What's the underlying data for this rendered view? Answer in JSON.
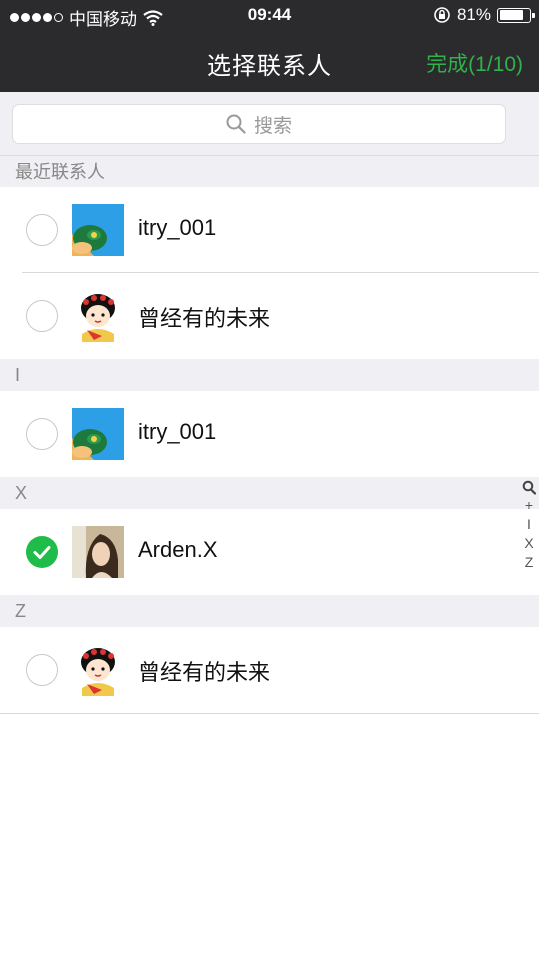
{
  "status": {
    "carrier": "中国移动",
    "time": "09:44",
    "battery": "81%",
    "battery_level": 0.81
  },
  "nav": {
    "title": "选择联系人",
    "done": "完成(1/10)"
  },
  "search": {
    "placeholder": "搜索"
  },
  "sections": [
    {
      "header": "最近联系人",
      "contacts": [
        {
          "name": "itry_001",
          "avatar": "hat-avatar",
          "selected": false
        },
        {
          "name": "曾经有的未来",
          "avatar": "cartoon-girl-avatar",
          "selected": false
        }
      ]
    },
    {
      "header": "I",
      "contacts": [
        {
          "name": "itry_001",
          "avatar": "hat-avatar",
          "selected": false
        }
      ]
    },
    {
      "header": "X",
      "contacts": [
        {
          "name": "Arden.X",
          "avatar": "photo-avatar",
          "selected": true
        }
      ]
    },
    {
      "header": "Z",
      "contacts": [
        {
          "name": "曾经有的未来",
          "avatar": "cartoon-girl-avatar",
          "selected": false
        }
      ]
    }
  ],
  "index_bar": [
    "+",
    "I",
    "X",
    "Z"
  ],
  "colors": {
    "accent": "#1fbc4a",
    "navbar": "#2b2b2e",
    "section_bg": "#efeff4"
  }
}
